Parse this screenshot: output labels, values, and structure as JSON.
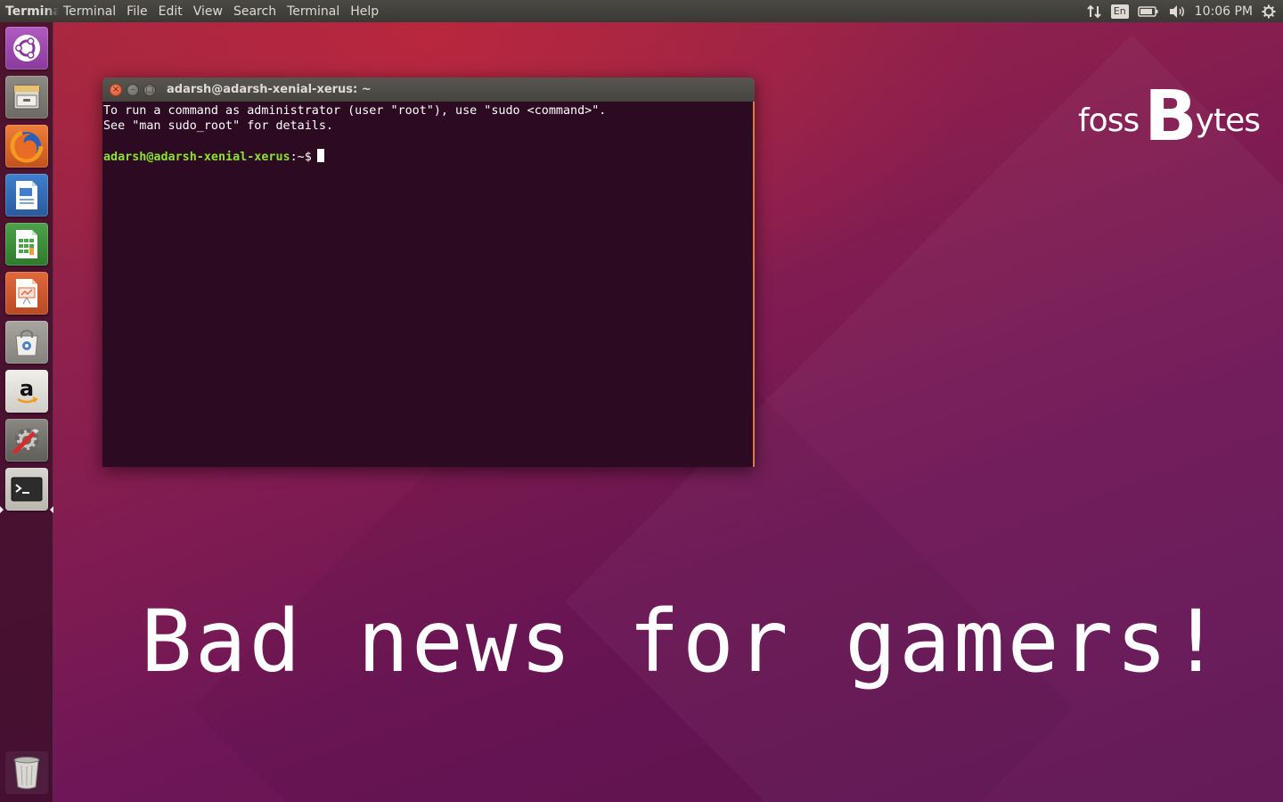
{
  "top_panel": {
    "app_name": "Terminal",
    "menus": [
      "Terminal",
      "File",
      "Edit",
      "View",
      "Search",
      "Terminal",
      "Help"
    ],
    "indicators": {
      "network_icon": "network-updown-icon",
      "keyboard_layout": "En",
      "battery_icon": "battery-icon",
      "volume_icon": "volume-icon",
      "clock": "10:06 PM",
      "session_icon": "gear-power-icon"
    }
  },
  "launcher": {
    "items": [
      {
        "name": "ubuntu-dash",
        "icon": "ubuntu-logo-icon"
      },
      {
        "name": "files",
        "icon": "file-cabinet-icon"
      },
      {
        "name": "firefox",
        "icon": "firefox-icon"
      },
      {
        "name": "libreoffice-writer",
        "icon": "writer-document-icon"
      },
      {
        "name": "libreoffice-calc",
        "icon": "calc-spreadsheet-icon"
      },
      {
        "name": "libreoffice-impress",
        "icon": "impress-presentation-icon"
      },
      {
        "name": "software-center",
        "icon": "shopping-bag-icon"
      },
      {
        "name": "amazon",
        "icon": "amazon-icon"
      },
      {
        "name": "system-settings",
        "icon": "settings-tools-icon"
      },
      {
        "name": "terminal",
        "icon": "terminal-icon",
        "active": true
      }
    ],
    "trash_icon": "trash-icon"
  },
  "terminal": {
    "title": "adarsh@adarsh-xenial-xerus: ~",
    "lines": [
      "To run a command as administrator (user \"root\"), use \"sudo <command>\".",
      "See \"man sudo_root\" for details."
    ],
    "prompt_user": "adarsh@adarsh-xenial-xerus",
    "prompt_sym": ":~$",
    "colors": {
      "background": "#2c0a22",
      "prompt": "#8ae234",
      "text": "#ffffff"
    }
  },
  "logo": {
    "part1": "foss",
    "part2": "B",
    "part3": "ytes"
  },
  "headline": "Bad news for gamers!",
  "colors": {
    "accent": "#e07a45",
    "panel": "#3a3935"
  }
}
